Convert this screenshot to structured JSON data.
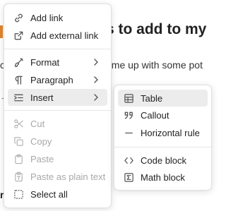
{
  "document": {
    "heading_visible": "s to add to my",
    "line_visible": "ome up with some pot",
    "edge_c": "c",
    "edge_arrow": "→",
    "edge_r": "r"
  },
  "context_menu": {
    "groups": [
      [
        {
          "label": "Add link",
          "icon": "link-icon",
          "disabled": false
        },
        {
          "label": "Add external link",
          "icon": "external-link-icon",
          "disabled": false
        }
      ],
      [
        {
          "label": "Format",
          "icon": "paintbrush-icon",
          "submenu": true
        },
        {
          "label": "Paragraph",
          "icon": "pilcrow-icon",
          "submenu": true
        },
        {
          "label": "Insert",
          "icon": "indent-list-icon",
          "submenu": true,
          "active": true
        }
      ],
      [
        {
          "label": "Cut",
          "icon": "scissors-icon",
          "disabled": true
        },
        {
          "label": "Copy",
          "icon": "copy-icon",
          "disabled": true
        },
        {
          "label": "Paste",
          "icon": "clipboard-icon",
          "disabled": true
        },
        {
          "label": "Paste as plain text",
          "icon": "clipboard-type-icon",
          "disabled": true
        },
        {
          "label": "Select all",
          "icon": "select-all-icon",
          "disabled": false
        }
      ]
    ]
  },
  "insert_submenu": {
    "groups": [
      [
        {
          "label": "Table",
          "icon": "table-icon",
          "active": true
        },
        {
          "label": "Callout",
          "icon": "quote-icon"
        },
        {
          "label": "Horizontal rule",
          "icon": "minus-icon"
        }
      ],
      [
        {
          "label": "Code block",
          "icon": "code-icon"
        },
        {
          "label": "Math block",
          "icon": "sigma-icon"
        }
      ]
    ]
  }
}
